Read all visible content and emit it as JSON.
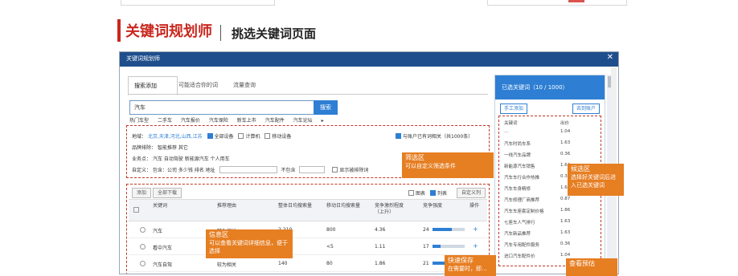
{
  "slide": {
    "title": "关键词规划师",
    "subtitle": "挑选关键词页面"
  },
  "window": {
    "title": "关键词规划师",
    "close": "✕"
  },
  "tabs": [
    "搜索添加",
    "可能适合你的词",
    "流量查询"
  ],
  "search": {
    "value": "汽车",
    "button": "搜索",
    "suggestions": [
      "热门车型",
      "二手车",
      "汽车报价",
      "汽车保险",
      "新车上市",
      "汽车配件",
      "汽车论坛"
    ]
  },
  "filters": {
    "region_label": "地域：",
    "region_value": "北京,天津,河北,山西,江苏",
    "device_all": "全部设备",
    "device_pc": "计算机",
    "device_mobile": "移动设备",
    "related_toggle": "与账户已有词相关（共1000条）",
    "brand_label": "品牌排除：",
    "brand_values": "智能推荐  其它",
    "business_label": "业务点：",
    "business_values": "汽车  自动驾驶  新能源汽车  个人用车",
    "custom_label": "自定义：",
    "custom_values": "包含：公司  多少钱  排名  地址",
    "exclude_label": "不包含",
    "exclude_check": "显示被排除词"
  },
  "table": {
    "btn_add": "添加",
    "btn_download": "全部下载",
    "view_chart": "图表",
    "view_list": "列表",
    "custom_cols": "自定义列",
    "headers": [
      "关键词",
      "推荐理由",
      "整体日均搜索量",
      "移动日均搜索量",
      "竞争激烈程度（上升）",
      "竞争强度",
      "操作"
    ],
    "rows": [
      {
        "keyword": "汽车",
        "reason": "较为相关",
        "total": "2,210",
        "mobile": "800",
        "comp": "4.36",
        "rank": "24",
        "bar": 0.6
      },
      {
        "keyword": "看中汽车",
        "reason": "较为相关",
        "total": "20",
        "mobile": "<5",
        "comp": "1.11",
        "rank": "17",
        "bar": 0.25
      },
      {
        "keyword": "汽车自驾",
        "reason": "较为相关",
        "total": "140",
        "mobile": "80",
        "comp": "1.86",
        "rank": "21",
        "bar": 0.4
      }
    ]
  },
  "panel": {
    "header": "已选关键词（10 / 1000）",
    "btn_manual": "手工添加",
    "btn_account": "去到账户",
    "col_keyword": "关键词",
    "col_bid": "出价",
    "items": [
      {
        "k": "...",
        "v": "1.04"
      },
      {
        "k": "汽车时尚车系",
        "v": "1.63"
      },
      {
        "k": "一线汽车品牌",
        "v": "0.36"
      },
      {
        "k": "新能源汽车销售",
        "v": "1.64"
      },
      {
        "k": "汽车车行合作热推",
        "v": "0.39"
      },
      {
        "k": "汽车车身精修",
        "v": "1.63"
      },
      {
        "k": "汽车修理厂商推荐",
        "v": "0.87"
      },
      {
        "k": "汽车车座套定制价格",
        "v": "1.86"
      },
      {
        "k": "七座车人气排行",
        "v": "1.63"
      },
      {
        "k": "汽车新品推荐",
        "v": "1.63"
      },
      {
        "k": "汽车专用配件服务",
        "v": "0.36"
      },
      {
        "k": "进口汽车配件价",
        "v": "1.04"
      }
    ]
  },
  "callouts": {
    "filter_title": "筛选区",
    "filter_sub": "可以自定义筛选条件",
    "info_title": "信息区",
    "info_sub": "可以查看关键词详细信息，便于选择",
    "pick_title": "候选区",
    "pick_sub": "选择好关键词后进入已选关键词",
    "save_title": "快速保存",
    "save_sub": "在需要时，即...",
    "preview_title": "查看预估"
  },
  "colors": {
    "accent": "#c9271e",
    "brand_blue": "#2e7fd4",
    "callout": "#e67e22"
  }
}
